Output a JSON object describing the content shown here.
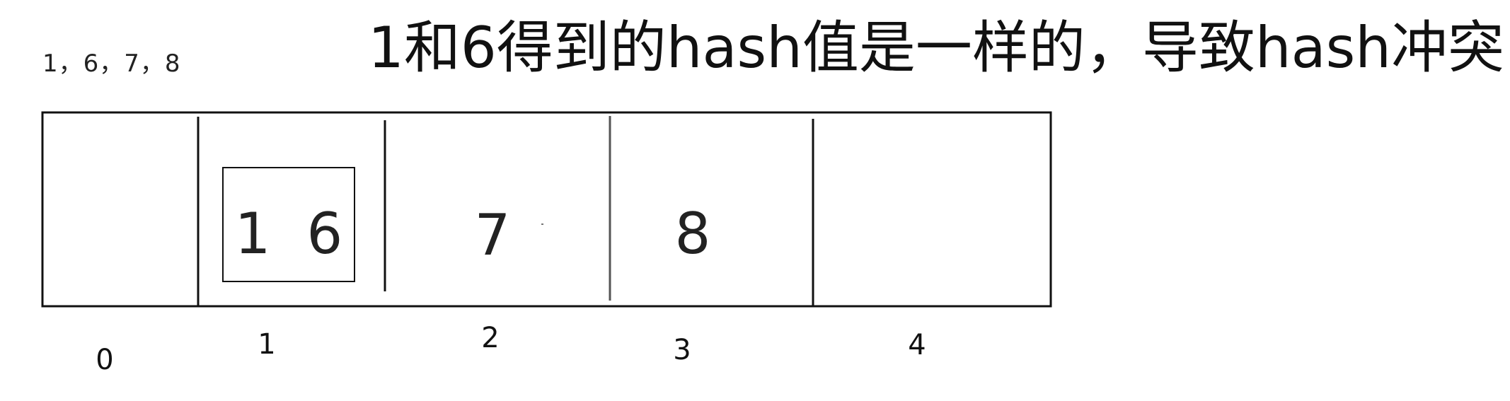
{
  "input": {
    "keys_label": "1，6，7，8"
  },
  "caption": {
    "text": "1和6得到的hash值是一样的，导致hash冲突"
  },
  "table": {
    "slots": [
      {
        "index": "0",
        "content": ""
      },
      {
        "index": "1",
        "content": "1  6"
      },
      {
        "index": "2",
        "content": "7"
      },
      {
        "index": "3",
        "content": "8"
      },
      {
        "index": "4",
        "content": ""
      }
    ]
  }
}
